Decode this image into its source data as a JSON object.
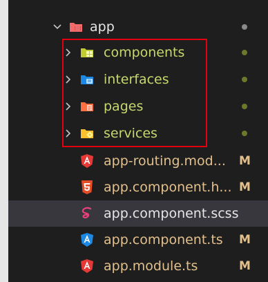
{
  "explorer": {
    "root": {
      "label": "app",
      "icon": "folder-app-icon",
      "status_color": "#8b8b8b"
    },
    "folders": [
      {
        "label": "components",
        "icon": "folder-components-icon",
        "color": "#c5d86d",
        "status_color": "#6a7a2a"
      },
      {
        "label": "interfaces",
        "icon": "folder-interfaces-icon",
        "color": "#cbd86d",
        "status_color": "#6a7a2a"
      },
      {
        "label": "pages",
        "icon": "folder-pages-icon",
        "color": "#c5d86d",
        "status_color": "#6a7a2a"
      },
      {
        "label": "services",
        "icon": "folder-services-icon",
        "color": "#c5d86d",
        "status_color": "#6a7a2a"
      }
    ],
    "files": [
      {
        "label": "app-routing.mod...",
        "icon": "angular-icon",
        "color": "#e2c08d",
        "badge": "M"
      },
      {
        "label": "app.component.h...",
        "icon": "html5-icon",
        "color": "#e2c08d",
        "badge": "M"
      },
      {
        "label": "app.component.scss",
        "icon": "sass-icon",
        "color": "#e6e6e6",
        "badge": ""
      },
      {
        "label": "app.component.ts",
        "icon": "angular-blue-icon",
        "color": "#e2c08d",
        "badge": "M"
      },
      {
        "label": "app.module.ts",
        "icon": "angular-icon",
        "color": "#e2c08d",
        "badge": "M"
      }
    ]
  },
  "colors": {
    "folder_text": "#c5d86d",
    "modified_text": "#e2c08d",
    "normal_text": "#e6e6e6",
    "highlight_border": "#e3000f"
  }
}
